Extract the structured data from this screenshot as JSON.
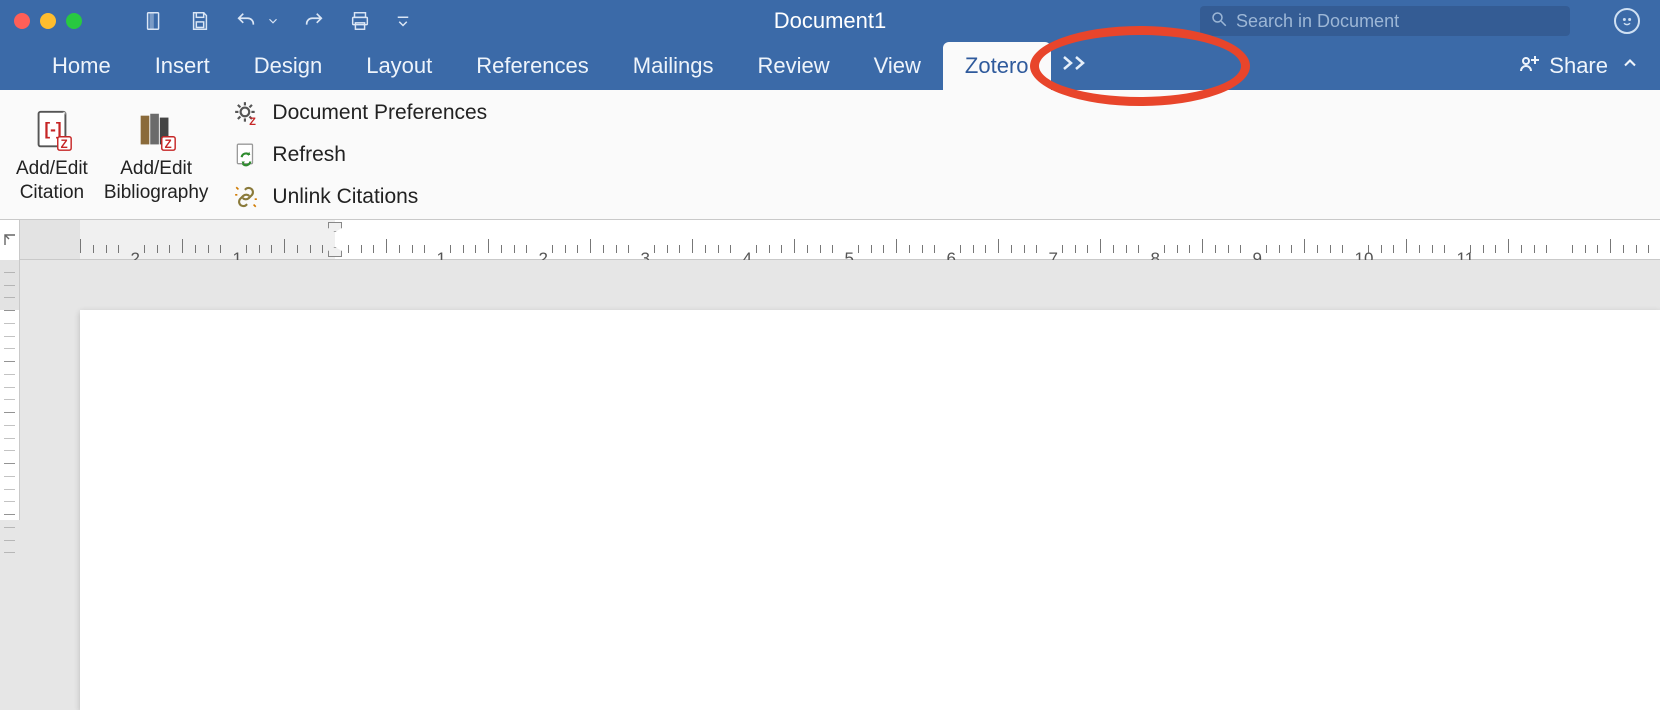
{
  "window": {
    "title": "Document1"
  },
  "search": {
    "placeholder": "Search in Document"
  },
  "tabs": [
    {
      "label": "Home"
    },
    {
      "label": "Insert"
    },
    {
      "label": "Design"
    },
    {
      "label": "Layout"
    },
    {
      "label": "References"
    },
    {
      "label": "Mailings"
    },
    {
      "label": "Review"
    },
    {
      "label": "View"
    },
    {
      "label": "Zotero"
    }
  ],
  "active_tab_index": 8,
  "share": {
    "label": "Share"
  },
  "ribbon": {
    "add_edit_citation": {
      "line1": "Add/Edit",
      "line2": "Citation"
    },
    "add_edit_bibliography": {
      "line1": "Add/Edit",
      "line2": "Bibliography"
    },
    "doc_prefs": "Document Preferences",
    "refresh": "Refresh",
    "unlink": "Unlink Citations"
  },
  "ruler": {
    "left_margin_label_2": "2",
    "left_margin_label_1": "1",
    "labels": [
      "1",
      "2",
      "3",
      "4",
      "5",
      "6",
      "7",
      "8",
      "9",
      "10",
      "11"
    ]
  },
  "annotation": {
    "shape": "ellipse",
    "color": "#e8452b",
    "target": "zotero-tab"
  }
}
